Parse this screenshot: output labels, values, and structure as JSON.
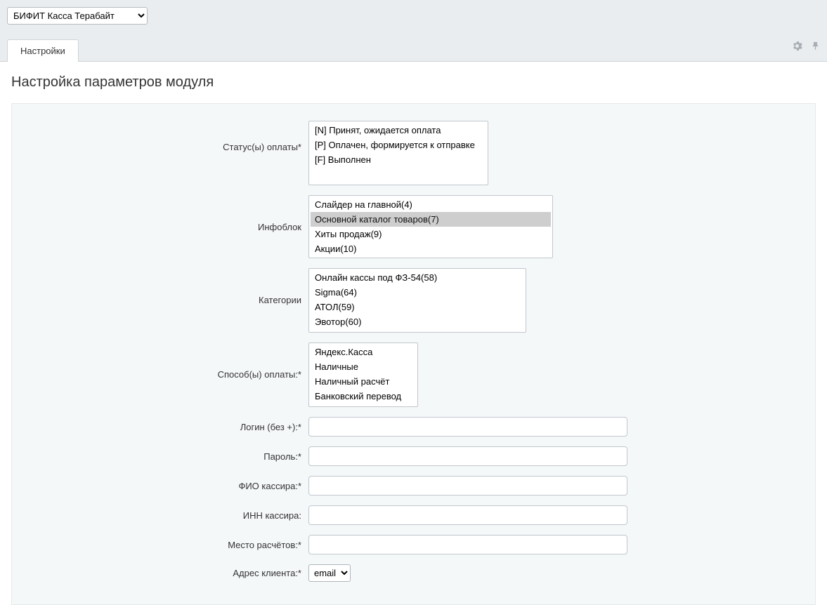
{
  "header": {
    "module_selected": "БИФИТ Касса Терабайт",
    "tab_label": "Настройки"
  },
  "page": {
    "title": "Настройка параметров модуля"
  },
  "fields": {
    "status": {
      "label": "Статус(ы) оплаты*",
      "options": [
        "[N] Принят, ожидается оплата",
        "[P] Оплачен, формируется к отправке",
        "[F] Выполнен"
      ]
    },
    "infoblock": {
      "label": "Инфоблок",
      "options": [
        "Слайдер на главной(4)",
        "Основной каталог товаров(7)",
        "Хиты продаж(9)",
        "Акции(10)"
      ],
      "selected_index": 1
    },
    "categories": {
      "label": "Категории",
      "options": [
        "Онлайн кассы под ФЗ-54(58)",
        "Sigma(64)",
        "АТОЛ(59)",
        "Эвотор(60)"
      ]
    },
    "payment": {
      "label": "Способ(ы) оплаты:*",
      "options": [
        "Яндекс.Касса",
        "Наличные",
        "Наличный расчёт",
        "Банковский перевод"
      ]
    },
    "login": {
      "label": "Логин (без +):*",
      "value": ""
    },
    "password": {
      "label": "Пароль:*",
      "value": ""
    },
    "cashier_name": {
      "label": "ФИО кассира:*",
      "value": ""
    },
    "cashier_inn": {
      "label": "ИНН кассира:",
      "value": ""
    },
    "place": {
      "label": "Место расчётов:*",
      "value": ""
    },
    "client_address": {
      "label": "Адрес клиента:*",
      "options": [
        "email"
      ],
      "selected": "email"
    }
  }
}
